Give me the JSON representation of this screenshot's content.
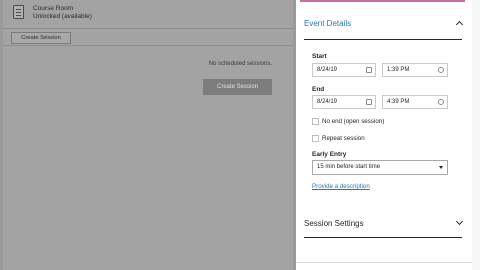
{
  "course": {
    "title": "Course Room",
    "status": "Unlocked (available)"
  },
  "left": {
    "create_session_tab": "Create Session",
    "empty_message": "No scheduled sessions.",
    "create_session_button": "Create Session"
  },
  "event_details": {
    "heading": "Event Details",
    "start_label": "Start",
    "start_date": "8/24/19",
    "start_time": "1:39 PM",
    "end_label": "End",
    "end_date": "8/24/19",
    "end_time": "4:39 PM",
    "no_end_label": "No end (open session)",
    "repeat_label": "Repeat session",
    "early_entry_label": "Early Entry",
    "early_entry_value": "15 min before start time",
    "description_link": "Provide a description"
  },
  "session_settings": {
    "heading": "Session Settings"
  },
  "colors": {
    "accent_link": "#1f78b8",
    "top_accent": "#c96fa8",
    "overlay_gray": "#a3a3a3"
  },
  "icons": [
    "document-icon",
    "calendar-icon",
    "clock-icon",
    "chevron-up-icon",
    "chevron-down-icon",
    "dropdown-caret-icon"
  ]
}
